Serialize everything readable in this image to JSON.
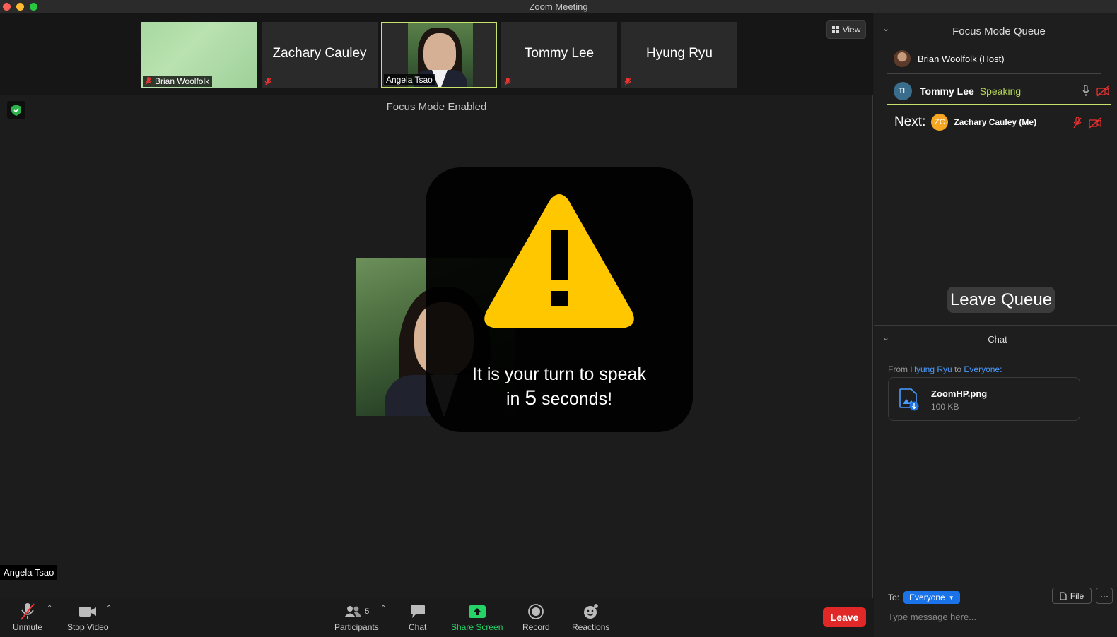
{
  "window": {
    "title": "Zoom Meeting"
  },
  "thumbnails": [
    {
      "name": "Brian Woolfolk",
      "muted": true
    },
    {
      "name": "Zachary Cauley",
      "muted": true
    },
    {
      "name": "Angela Tsao",
      "muted": false,
      "active": true
    },
    {
      "name": "Tommy Lee",
      "muted": true
    },
    {
      "name": "Hyung Ryu",
      "muted": true
    }
  ],
  "view_button": {
    "label": "View"
  },
  "focus_mode": {
    "status": "Focus Mode Enabled"
  },
  "alert": {
    "line1": "It is your turn to speak",
    "line2_prefix": "in ",
    "seconds": "5",
    "line2_suffix": " seconds!"
  },
  "active_speaker": {
    "label": "Angela Tsao"
  },
  "toolbar": {
    "unmute": "Unmute",
    "stop_video": "Stop Video",
    "participants": "Participants",
    "participants_count": "5",
    "chat": "Chat",
    "share_screen": "Share Screen",
    "record": "Record",
    "reactions": "Reactions",
    "leave": "Leave"
  },
  "queue": {
    "title": "Focus Mode Queue",
    "host": "Brian Woolfolk (Host)",
    "speaking": {
      "initials": "TL",
      "name": "Tommy Lee",
      "status": "Speaking"
    },
    "next_label": "Next:",
    "next": {
      "initials": "ZC",
      "name": "Zachary Cauley (Me)"
    },
    "leave_button": "Leave Queue"
  },
  "chat": {
    "title": "Chat",
    "from_prefix": "From ",
    "from_name": "Hyung Ryu",
    "from_mid": " to ",
    "from_to": "Everyone:",
    "file": {
      "name": "ZoomHP.png",
      "size": "100 KB"
    },
    "to_label": "To:",
    "to_value": "Everyone",
    "file_button": "File",
    "more_button": "···",
    "input_placeholder": "Type message here..."
  },
  "colors": {
    "speaking_accent": "#c5e36a",
    "leave_red": "#e02828",
    "link_blue": "#4a9cff",
    "share_green": "#25d366",
    "warning_yellow": "#ffc700"
  }
}
